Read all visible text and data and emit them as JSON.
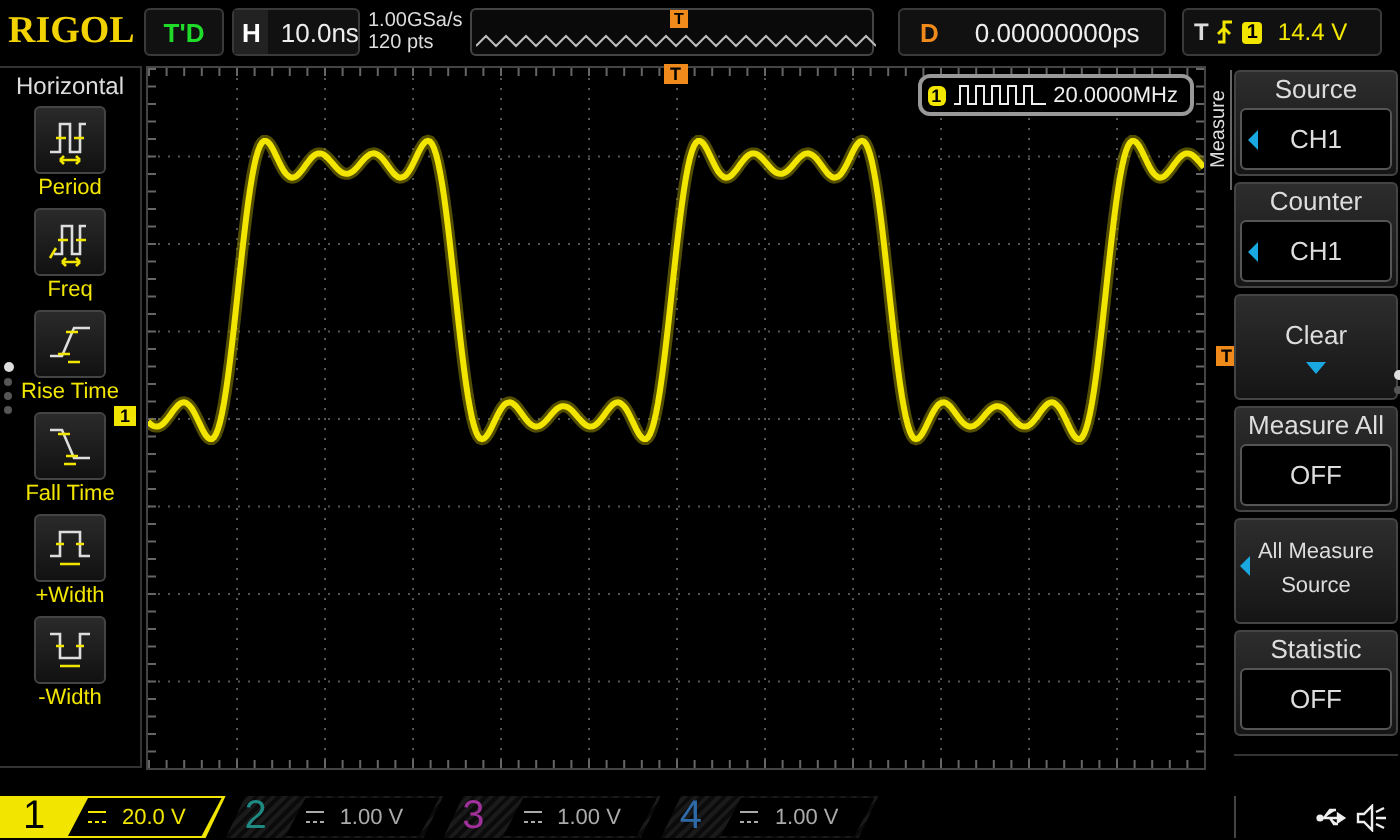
{
  "brand": "RIGOL",
  "run_status": "T'D",
  "horizontal": {
    "label": "H",
    "value": "10.0ns"
  },
  "acquisition": {
    "sample_rate": "1.00GSa/s",
    "memory_depth": "120 pts",
    "trigger_marker": "T"
  },
  "delay": {
    "label": "D",
    "value": "0.00000000ps"
  },
  "trigger": {
    "label": "T",
    "source": "1",
    "level": "14.4 V"
  },
  "display": {
    "trigger_position_marker": "T",
    "channel_marker": "1",
    "trigger_level_marker": "T",
    "counter": {
      "channel": "1",
      "value": "20.0000MHz"
    }
  },
  "left_menu": {
    "title": "Horizontal",
    "items": [
      {
        "kind": "period",
        "label": "Period"
      },
      {
        "kind": "freq",
        "label": "Freq"
      },
      {
        "kind": "rise",
        "label": "Rise Time"
      },
      {
        "kind": "fall",
        "label": "Fall Time"
      },
      {
        "kind": "pwidth",
        "label": "+Width"
      },
      {
        "kind": "nwidth",
        "label": "-Width"
      }
    ],
    "pages": [
      {
        "selected": true
      },
      {
        "selected": false
      },
      {
        "selected": false
      },
      {
        "selected": false
      }
    ]
  },
  "right_menu": {
    "title": "Measure",
    "items": [
      {
        "kind": "option",
        "label": "Source",
        "value": "CH1"
      },
      {
        "kind": "option",
        "label": "Counter",
        "value": "CH1"
      },
      {
        "kind": "action",
        "label": "Clear"
      },
      {
        "kind": "setting",
        "label": "Measure All",
        "value": "OFF"
      },
      {
        "kind": "submenu",
        "label": "All Measure Source"
      },
      {
        "kind": "setting",
        "label": "Statistic",
        "value": "OFF"
      }
    ],
    "pages": [
      {
        "selected": true
      },
      {
        "selected": false
      }
    ]
  },
  "channels": [
    {
      "number": "1",
      "scale": "20.0 V",
      "selected": true,
      "color": "#f2e600"
    },
    {
      "number": "2",
      "scale": "1.00 V",
      "selected": false,
      "color": "#1f8a84"
    },
    {
      "number": "3",
      "scale": "1.00 V",
      "selected": false,
      "color": "#a0309a"
    },
    {
      "number": "4",
      "scale": "1.00 V",
      "selected": false,
      "color": "#2f6aa8"
    }
  ]
}
